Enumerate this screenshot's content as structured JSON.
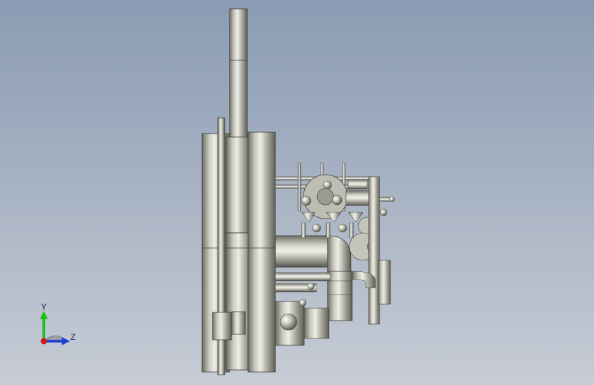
{
  "viewport": {
    "background_top": "#8a9bb3",
    "background_bottom": "#c7ccd5"
  },
  "model": {
    "body_color": "#a9a9a0",
    "dark_color": "#5b5b55",
    "light_color": "#e4e4dc"
  },
  "triad": {
    "y_label": "Y",
    "z_label": "Z",
    "y_color": "#19c019",
    "z_color": "#1f3fd6",
    "x_color": "#d01919",
    "plane_color": "#9aa0a8"
  }
}
